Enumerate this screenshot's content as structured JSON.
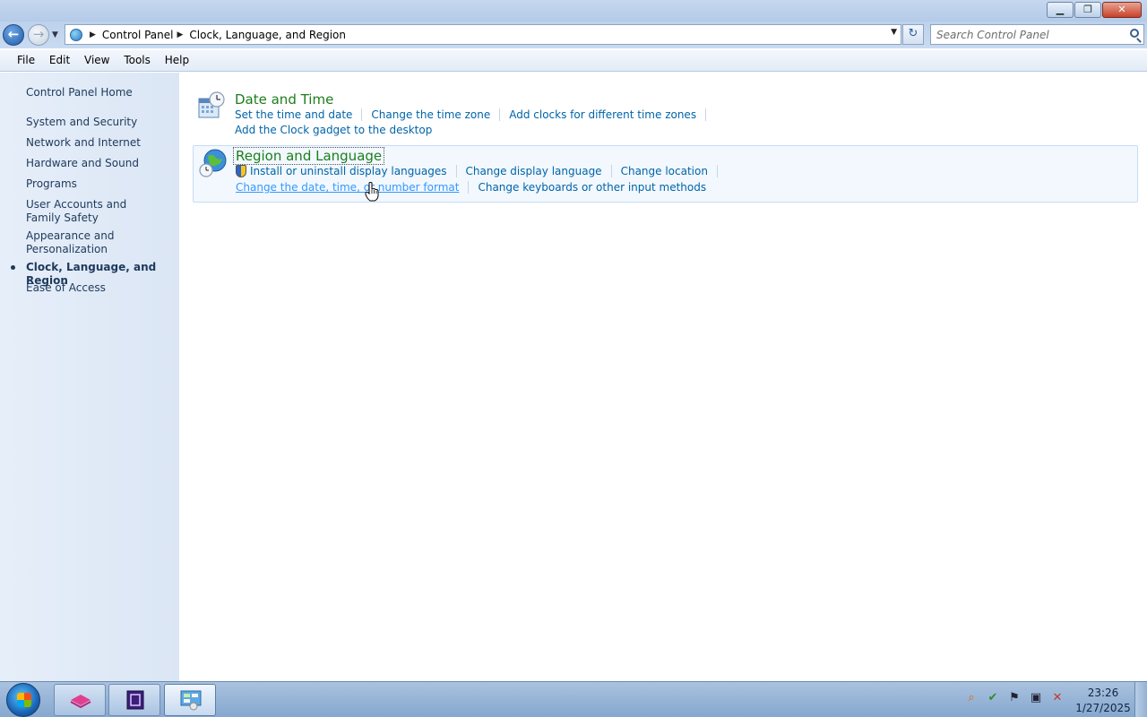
{
  "window": {
    "caption": {
      "minimize": "▁",
      "restore": "❐",
      "close": "✕"
    }
  },
  "address_bar": {
    "back_glyph": "←",
    "forward_glyph": "→",
    "breadcrumbs": [
      "Control Panel",
      "Clock, Language, and Region"
    ],
    "search_placeholder": "Search Control Panel",
    "refresh_glyph": "↻"
  },
  "menu": [
    "File",
    "Edit",
    "View",
    "Tools",
    "Help"
  ],
  "sidebar": {
    "items": [
      {
        "label": "Control Panel Home"
      },
      {
        "label": "System and Security"
      },
      {
        "label": "Network and Internet"
      },
      {
        "label": "Hardware and Sound"
      },
      {
        "label": "Programs"
      },
      {
        "label": "User Accounts and Family Safety"
      },
      {
        "label": "Appearance and Personalization"
      },
      {
        "label": "Clock, Language, and Region",
        "current": true
      },
      {
        "label": "Ease of Access"
      }
    ]
  },
  "groups": [
    {
      "title": "Date and Time",
      "icon": "date-time-icon",
      "links": [
        [
          "Set the time and date",
          "Change the time zone",
          "Add clocks for different time zones"
        ],
        [
          "Add the Clock gadget to the desktop"
        ]
      ]
    },
    {
      "title": "Region and Language",
      "icon": "region-language-icon",
      "links": [
        [
          "Install or uninstall display languages",
          "Change display language",
          "Change location"
        ],
        [
          "Change the date, time, or number format",
          "Change keyboards or other input methods"
        ]
      ]
    }
  ],
  "taskbar": {
    "tray_icons": [
      "network-search-icon",
      "security-check-icon",
      "action-center-flag-icon",
      "display-icon",
      "volume-muted-icon"
    ],
    "clock_time": "23:26",
    "clock_date": "1/27/2025"
  },
  "colors": {
    "group_title": "#1c7e1c",
    "link": "#0064a8",
    "link_hover": "#3399ff"
  }
}
